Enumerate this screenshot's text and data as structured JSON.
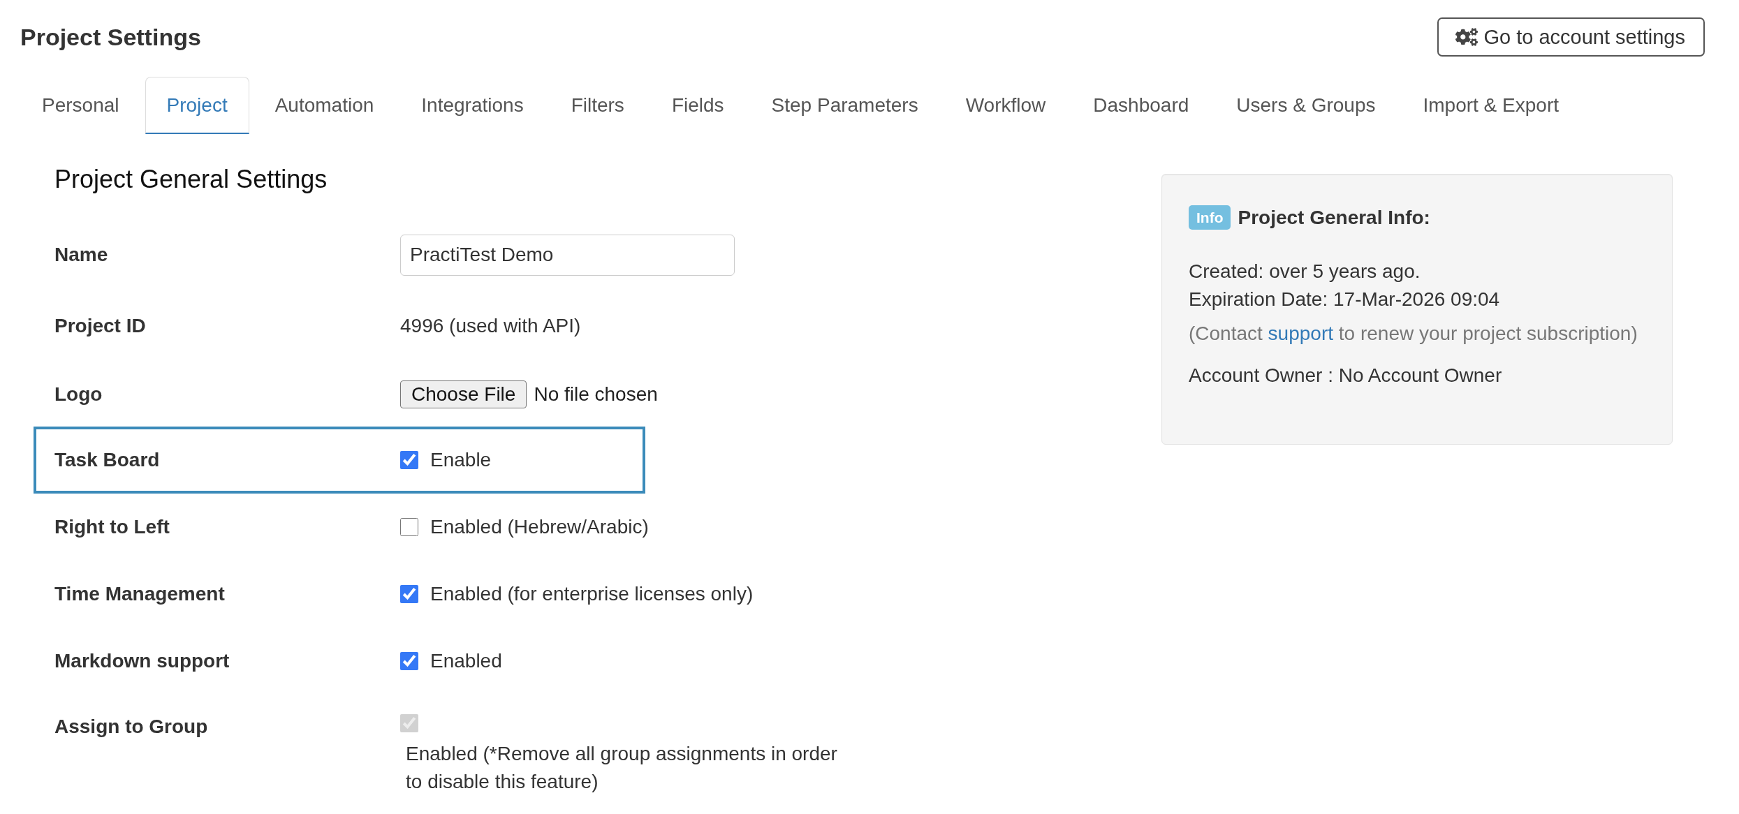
{
  "header": {
    "title": "Project Settings",
    "account_button": "Go to account settings"
  },
  "tabs": [
    {
      "label": "Personal",
      "selected": false
    },
    {
      "label": "Project",
      "selected": true
    },
    {
      "label": "Automation",
      "selected": false
    },
    {
      "label": "Integrations",
      "selected": false
    },
    {
      "label": "Filters",
      "selected": false
    },
    {
      "label": "Fields",
      "selected": false
    },
    {
      "label": "Step Parameters",
      "selected": false
    },
    {
      "label": "Workflow",
      "selected": false
    },
    {
      "label": "Dashboard",
      "selected": false
    },
    {
      "label": "Users & Groups",
      "selected": false
    },
    {
      "label": "Import & Export",
      "selected": false
    }
  ],
  "general_settings": {
    "title": "Project General Settings",
    "fields": [
      {
        "kind": "text_input",
        "label": "Name",
        "value": "PractiTest Demo",
        "highlighted": false
      },
      {
        "kind": "text",
        "label": "Project ID",
        "value": "4996 (used with API)",
        "highlighted": false
      },
      {
        "kind": "file",
        "label": "Logo",
        "button": "Choose File",
        "status": "No file chosen",
        "highlighted": false
      },
      {
        "kind": "checkbox",
        "label": "Task Board",
        "option": "Enable",
        "checked": true,
        "disabled": false,
        "highlighted": true
      },
      {
        "kind": "checkbox",
        "label": "Right to Left",
        "option": "Enabled (Hebrew/Arabic)",
        "checked": false,
        "disabled": false,
        "highlighted": false
      },
      {
        "kind": "checkbox",
        "label": "Time Management",
        "option": "Enabled (for enterprise licenses only)",
        "checked": true,
        "disabled": false,
        "highlighted": false
      },
      {
        "kind": "checkbox",
        "label": "Markdown support",
        "option": "Enabled",
        "checked": true,
        "disabled": false,
        "highlighted": false
      },
      {
        "kind": "checkbox_below",
        "label": "Assign to Group",
        "option": "Enabled (*Remove all group assignments in order to disable this feature)",
        "checked": true,
        "disabled": true,
        "highlighted": false
      }
    ]
  },
  "info_panel": {
    "badge": "Info",
    "title": "Project General Info:",
    "details": [
      "Created: over 5 years ago.",
      "Expiration Date: 17-Mar-2026 09:04"
    ],
    "contact": {
      "before": "(Contact",
      "link": "support",
      "after": "to renew your project subscription)"
    },
    "owner": "Account Owner : No Account Owner"
  }
}
